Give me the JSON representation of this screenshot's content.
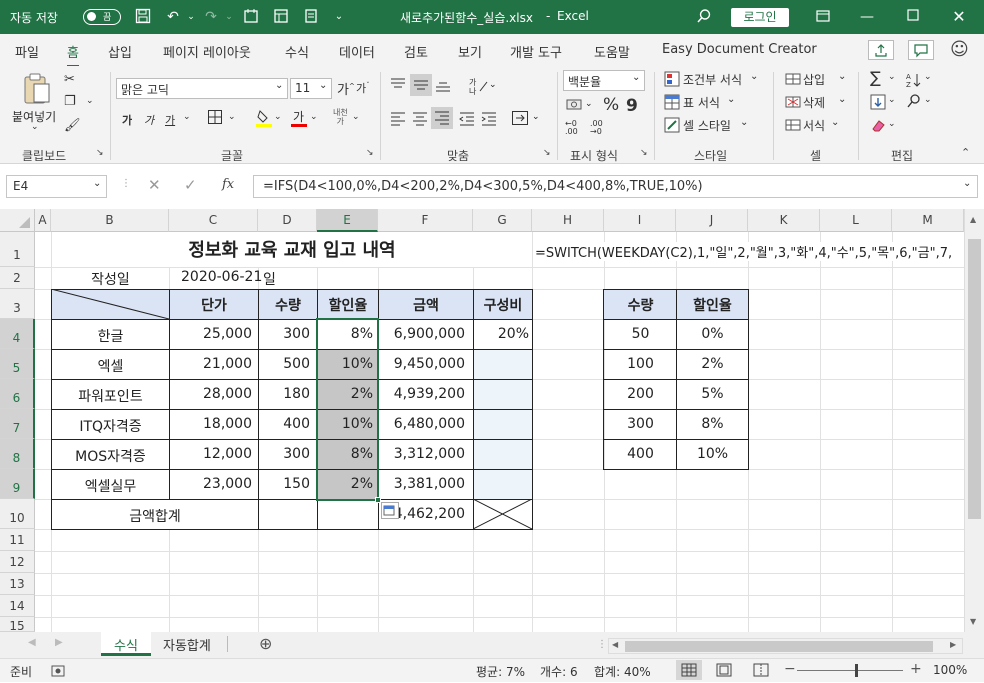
{
  "titlebar": {
    "autosave_label": "자동 저장",
    "toggle_state": "끔",
    "filename": "새로추가된함수_실습.xlsx",
    "app": "Excel",
    "login": "로그인"
  },
  "menu": [
    "파일",
    "홈",
    "삽입",
    "페이지 레이아웃",
    "수식",
    "데이터",
    "검토",
    "보기",
    "개발 도구",
    "도움말",
    "Easy Document Creator"
  ],
  "ribbon": {
    "paste": "붙여넣기",
    "font_name": "맑은 고딕",
    "font_size": "11",
    "number_format": "백분율",
    "cond_format": "조건부 서식",
    "table_format": "표 서식",
    "cell_style": "셀 스타일",
    "insert": "삽입",
    "delete": "삭제",
    "format": "서식",
    "groups": [
      "클립보드",
      "글꼴",
      "맞춤",
      "표시 형식",
      "스타일",
      "셀",
      "편집"
    ]
  },
  "formula_bar": {
    "name_box": "E4",
    "fx": "fx",
    "formula": "=IFS(D4<100,0%,D4<200,2%,D4<300,5%,D4<400,8%,TRUE,10%)"
  },
  "columns": [
    "A",
    "B",
    "C",
    "D",
    "E",
    "F",
    "G",
    "H",
    "I",
    "J",
    "K",
    "L",
    "M"
  ],
  "rows": [
    "1",
    "2",
    "3",
    "4",
    "5",
    "6",
    "7",
    "8",
    "9",
    "10",
    "11",
    "12",
    "13",
    "14",
    "15"
  ],
  "sheet": {
    "title": "정보화 교육 교재 입고 내역",
    "switch_formula": "=SWITCH(WEEKDAY(C2),1,\"일\",2,\"월\",3,\"화\",4,\"수\",5,\"목\",6,\"금\",7,",
    "date_label": "작성일",
    "date_value": "2020-06-21",
    "weekday": "일",
    "headers": [
      "단가",
      "수량",
      "할인율",
      "금액",
      "구성비"
    ],
    "items": [
      {
        "name": "한글",
        "price": "25,000",
        "qty": "300",
        "rate": "8%",
        "amount": "6,900,000",
        "ratio": "20%"
      },
      {
        "name": "엑셀",
        "price": "21,000",
        "qty": "500",
        "rate": "10%",
        "amount": "9,450,000",
        "ratio": ""
      },
      {
        "name": "파워포인트",
        "price": "28,000",
        "qty": "180",
        "rate": "2%",
        "amount": "4,939,200",
        "ratio": ""
      },
      {
        "name": "ITQ자격증",
        "price": "18,000",
        "qty": "400",
        "rate": "10%",
        "amount": "6,480,000",
        "ratio": ""
      },
      {
        "name": "MOS자격증",
        "price": "12,000",
        "qty": "300",
        "rate": "8%",
        "amount": "3,312,000",
        "ratio": ""
      },
      {
        "name": "엑셀실무",
        "price": "23,000",
        "qty": "150",
        "rate": "2%",
        "amount": "3,381,000",
        "ratio": ""
      }
    ],
    "total_label": "금액합계",
    "total_value": "34,462,200",
    "lookup_headers": [
      "수량",
      "할인율"
    ],
    "lookup": [
      {
        "qty": "50",
        "rate": "0%"
      },
      {
        "qty": "100",
        "rate": "2%"
      },
      {
        "qty": "200",
        "rate": "5%"
      },
      {
        "qty": "300",
        "rate": "8%"
      },
      {
        "qty": "400",
        "rate": "10%"
      }
    ]
  },
  "tabs": [
    "수식",
    "자동합계"
  ],
  "status": {
    "ready": "준비",
    "average": "평균: 7%",
    "count": "개수: 6",
    "sum": "합계: 40%",
    "zoom": "100%"
  },
  "colors": {
    "accent": "#217346",
    "header_fill": "#dbe4f5",
    "selection_fill": "#c6c6c6"
  }
}
